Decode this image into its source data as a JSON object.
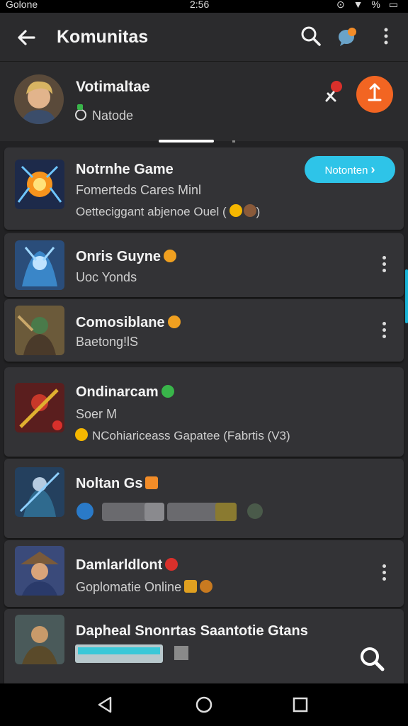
{
  "status": {
    "left": "Golone",
    "time": "2:56",
    "right": "% "
  },
  "appbar": {
    "title": "Komunitas",
    "icons": [
      "back-arrow-icon",
      "search-icon",
      "chat-bubble-icon",
      "more-icon"
    ]
  },
  "profile": {
    "name": "Votimaltae",
    "status": "Natode"
  },
  "follow_label": "Notonten",
  "communities": [
    {
      "name": "Notrnhe Game",
      "sub": "Fomerteds Cares Minl",
      "extra": "Oetteciggant abjenoe Ouel (",
      "extra_end": ")"
    },
    {
      "name": "Onris Guyne",
      "sub": "Uoc Yonds"
    },
    {
      "name": "Comosiblane",
      "sub": "Baetong!lS"
    },
    {
      "name": "Ondinarcam",
      "sub": "Soer M",
      "extra": "NCohiariceass Gapatee (Fabrtis (V3)"
    },
    {
      "name": "Noltan Gs"
    },
    {
      "name": "Damlarldlont",
      "sub": "Goplomatie Online"
    },
    {
      "name": "Dapheal Snonrtas Saantotie Gtans"
    }
  ],
  "colors": {
    "accent_cyan": "#2ec4e8",
    "fab_orange": "#f26522",
    "online_green": "#39b54a",
    "card_bg": "#333336"
  }
}
